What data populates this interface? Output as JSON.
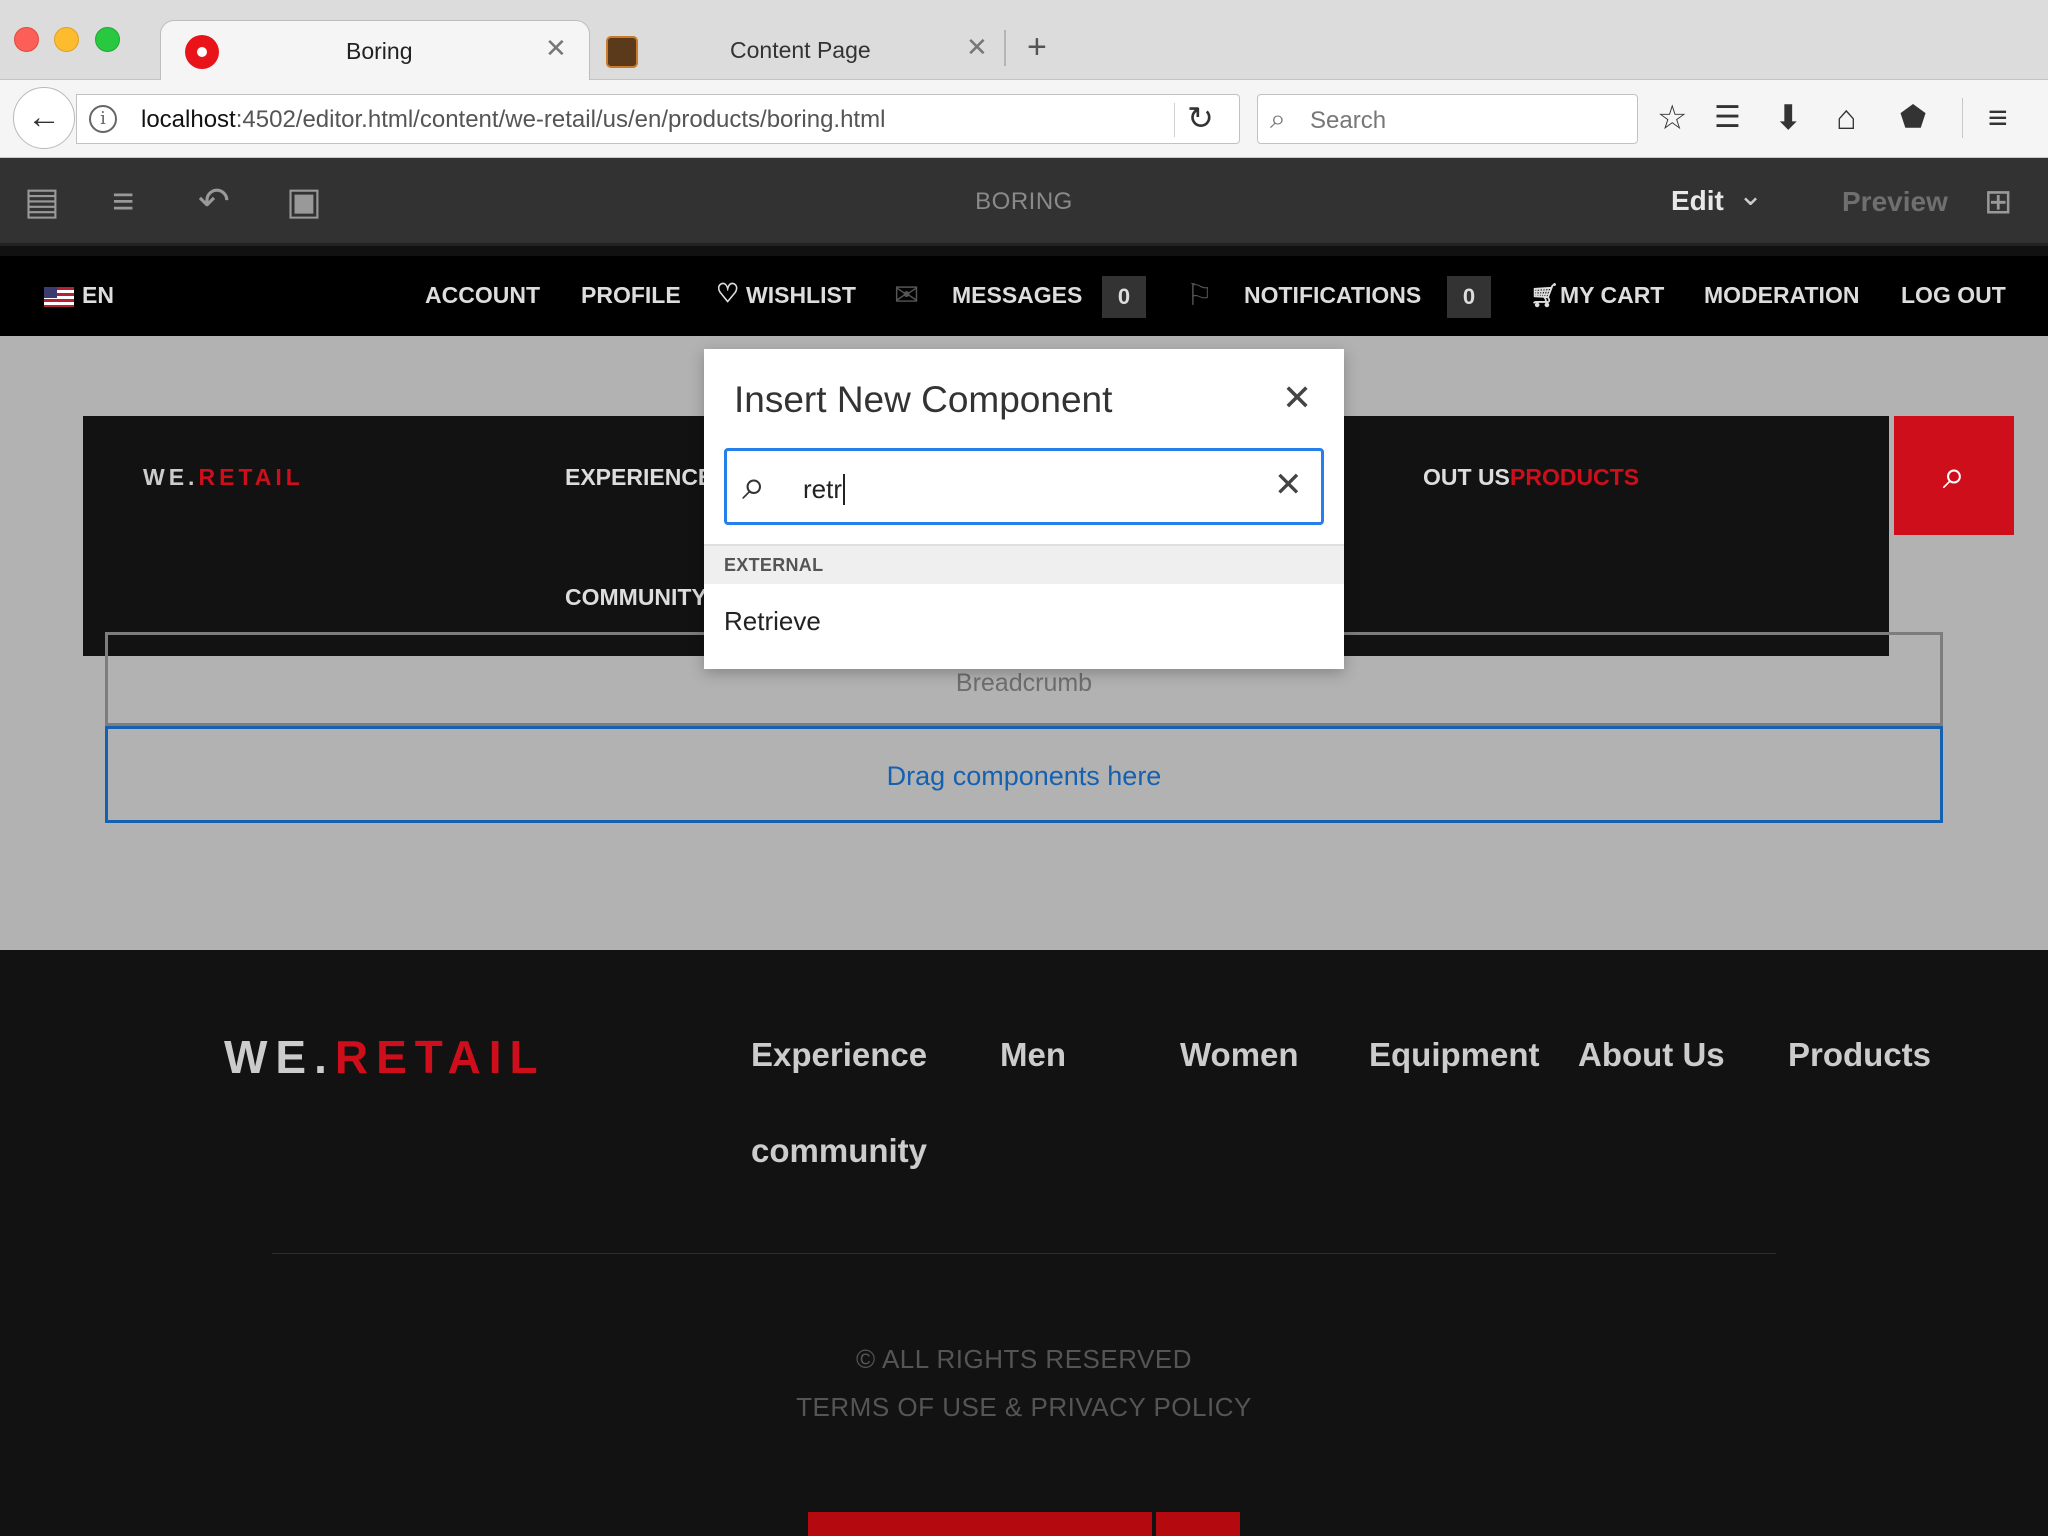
{
  "browser": {
    "tabs": [
      {
        "title": "Boring",
        "close": "✕"
      },
      {
        "title": "Content Page",
        "close": "✕"
      }
    ],
    "new_tab": "+",
    "url_host": "localhost",
    "url_path": ":4502/editor.html/content/we-retail/us/en/products/boring.html",
    "search_placeholder": "Search"
  },
  "editor": {
    "page_title": "BORING",
    "mode": "Edit",
    "preview": "Preview"
  },
  "site_header": {
    "language": "EN",
    "links": {
      "account": "ACCOUNT",
      "profile": "PROFILE",
      "wishlist": "WISHLIST",
      "messages": "MESSAGES",
      "messages_count": "0",
      "notifications": "NOTIFICATIONS",
      "notifications_count": "0",
      "cart": "MY CART",
      "moderation": "MODERATION",
      "logout": "LOG OUT"
    }
  },
  "site_nav": {
    "brand_prefix": "WE.",
    "brand_suffix": "RETAIL",
    "experience": "EXPERIENCE",
    "about_partial": "OUT US",
    "products": "PRODUCTS",
    "community": "COMMUNITY"
  },
  "placeholders": {
    "breadcrumb": "Breadcrumb",
    "drop_zone": "Drag components here"
  },
  "modal": {
    "title": "Insert New Component",
    "search_value": "retr",
    "group": "EXTERNAL",
    "results": [
      "Retrieve"
    ]
  },
  "footer": {
    "brand_prefix": "WE.",
    "brand_suffix": "RETAIL",
    "nav": [
      "Experience",
      "Men",
      "Women",
      "Equipment",
      "About Us",
      "Products",
      "community"
    ],
    "copyright": "© ALL RIGHTS RESERVED",
    "terms": "TERMS OF USE & PRIVACY POLICY"
  },
  "colors": {
    "brand_red": "#cf0e1c",
    "focus_blue": "#2680eb",
    "drop_blue": "#1461b2"
  }
}
